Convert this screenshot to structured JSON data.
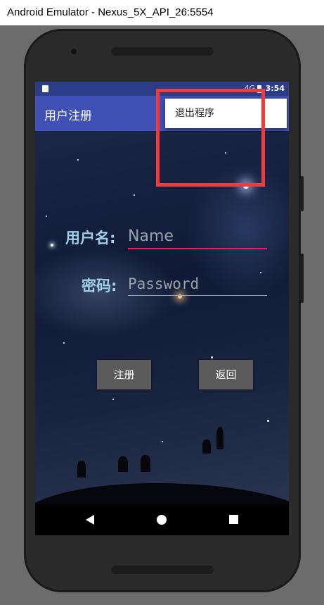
{
  "window": {
    "title": "Android Emulator - Nexus_5X_API_26:5554"
  },
  "statusbar": {
    "time": "3:54",
    "signal": "4G"
  },
  "appbar": {
    "title": "用户注册"
  },
  "overflow_menu": {
    "items": [
      {
        "label": "退出程序"
      }
    ]
  },
  "form": {
    "username_label": "用户名:",
    "username_placeholder": "Name",
    "password_label": "密码:",
    "password_placeholder": "Password"
  },
  "buttons": {
    "register": "注册",
    "back": "返回"
  },
  "colors": {
    "appbar": "#3f51b5",
    "statusbar": "#2c3c86",
    "input_accent": "#e91e63",
    "highlight": "#ee3b3b",
    "label": "#9fd0e8"
  },
  "icons": [
    "sd-card-icon",
    "signal-icon",
    "battery-icon",
    "nav-back-icon",
    "nav-home-icon",
    "nav-recent-icon"
  ]
}
